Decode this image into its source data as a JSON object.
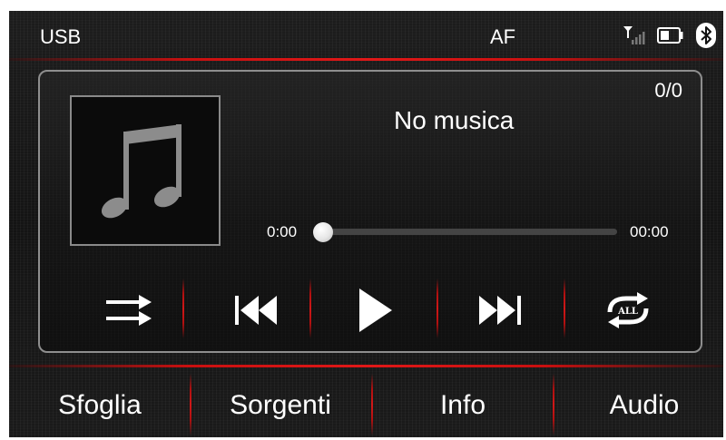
{
  "status_bar": {
    "source": "USB",
    "radio_mode": "AF",
    "icons": [
      "signal-icon",
      "battery-icon",
      "bluetooth-icon"
    ]
  },
  "player": {
    "track_counter": "0/0",
    "title": "No musica",
    "elapsed": "0:00",
    "total": "00:00",
    "progress": 0,
    "album_art_icon": "music-note-icon",
    "controls": [
      "shuffle-icon",
      "previous-track-icon",
      "play-icon",
      "next-track-icon",
      "repeat-all-icon"
    ],
    "repeat_badge": "ALL"
  },
  "menu": {
    "browse": "Sfoglia",
    "sources": "Sorgenti",
    "info": "Info",
    "audio": "Audio"
  },
  "colors": {
    "accent_red": "#d01818",
    "background": "#161616",
    "panel_border": "#8e8e8e",
    "text": "#ffffff",
    "icon_grey": "#8c8c8c"
  }
}
